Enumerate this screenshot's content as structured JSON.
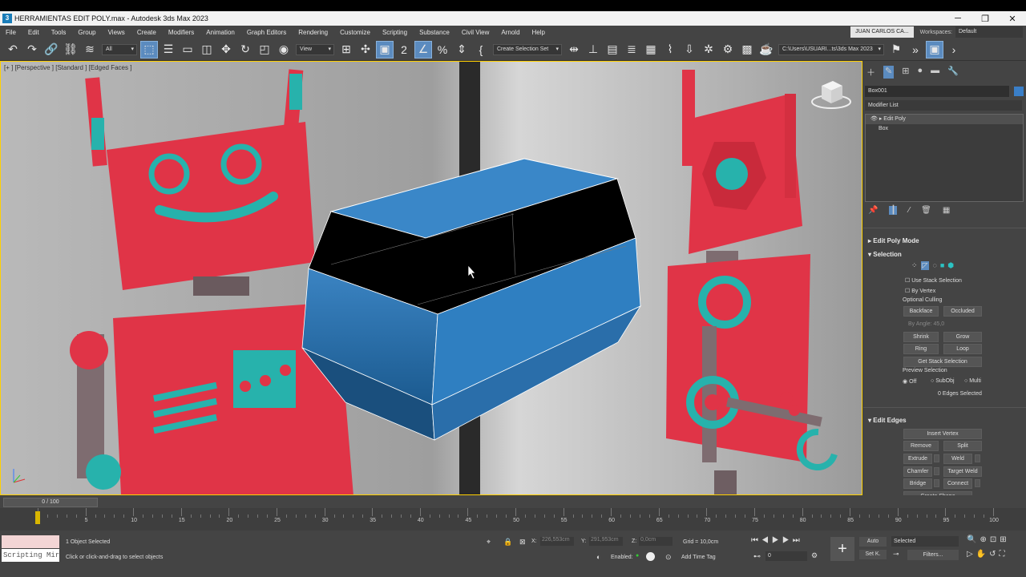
{
  "window": {
    "title": "HERRAMIENTAS EDIT POLY.max - Autodesk 3ds Max 2023",
    "min": "─",
    "max": "❐",
    "close": "✕"
  },
  "menu": [
    "File",
    "Edit",
    "Tools",
    "Group",
    "Views",
    "Create",
    "Modifiers",
    "Animation",
    "Graph Editors",
    "Rendering",
    "Customize",
    "Scripting",
    "Substance",
    "Civil View",
    "Arnold",
    "Help"
  ],
  "user": "JUAN CARLOS CA...",
  "workspaces_label": "Workspaces:",
  "workspace": "Default",
  "toolbar": {
    "filter": "All",
    "coord": "View",
    "selset": "Create Selection Set",
    "path": "C:\\Users\\USUARI...ts\\3ds Max 2023"
  },
  "viewport": {
    "label": "[+ ] [Perspective ] [Standard ] [Edged Faces ]"
  },
  "cmd": {
    "object_name": "Box001",
    "modifier_list": "Modifier List",
    "stack": [
      "Edit Poly",
      "Box"
    ]
  },
  "rollouts": {
    "edit_poly_mode": "Edit Poly Mode",
    "selection": "Selection",
    "use_stack": "Use Stack Selection",
    "by_vertex": "By Vertex",
    "ignore_culling": "Optional Culling",
    "backface": "Backface",
    "occluded": "Occluded",
    "by_angle": "By Angle:",
    "angle_val": "45,0",
    "shrink": "Shrink",
    "grow": "Grow",
    "ring": "Ring",
    "loop": "Loop",
    "get_stack": "Get Stack Selection",
    "preview": "Preview Selection",
    "off": "Off",
    "subobj": "SubObj",
    "multi": "Multi",
    "edges_selected": "0 Edges Selected",
    "edit_edges": "Edit Edges",
    "insert_vertex": "Insert Vertex",
    "remove": "Remove",
    "split": "Split",
    "extrude": "Extrude",
    "weld": "Weld",
    "chamfer": "Chamfer",
    "target_weld": "Target Weld",
    "bridge": "Bridge",
    "connect": "Connect",
    "create_shape": "Create Shape"
  },
  "timeline": {
    "frame": "0 / 100",
    "ticks": [
      "0",
      "5",
      "10",
      "15",
      "20",
      "25",
      "30",
      "35",
      "40",
      "45",
      "50",
      "55",
      "60",
      "65",
      "70",
      "75",
      "80",
      "85",
      "90",
      "95",
      "100"
    ]
  },
  "status": {
    "script": "Scripting Mir",
    "selected": "1 Object Selected",
    "prompt": "Click or click-and-drag to select objects",
    "x": "X:",
    "xv": "226,553cm",
    "y": "Y:",
    "yv": "291,953cm",
    "z": "Z:",
    "zv": "0,0cm",
    "grid": "Grid = 10,0cm",
    "enabled": "Enabled:",
    "addtag": "Add Time Tag",
    "auto": "Auto",
    "setk": "Set K.",
    "selmode": "Selected",
    "filters": "Filters...",
    "frame": "0"
  }
}
